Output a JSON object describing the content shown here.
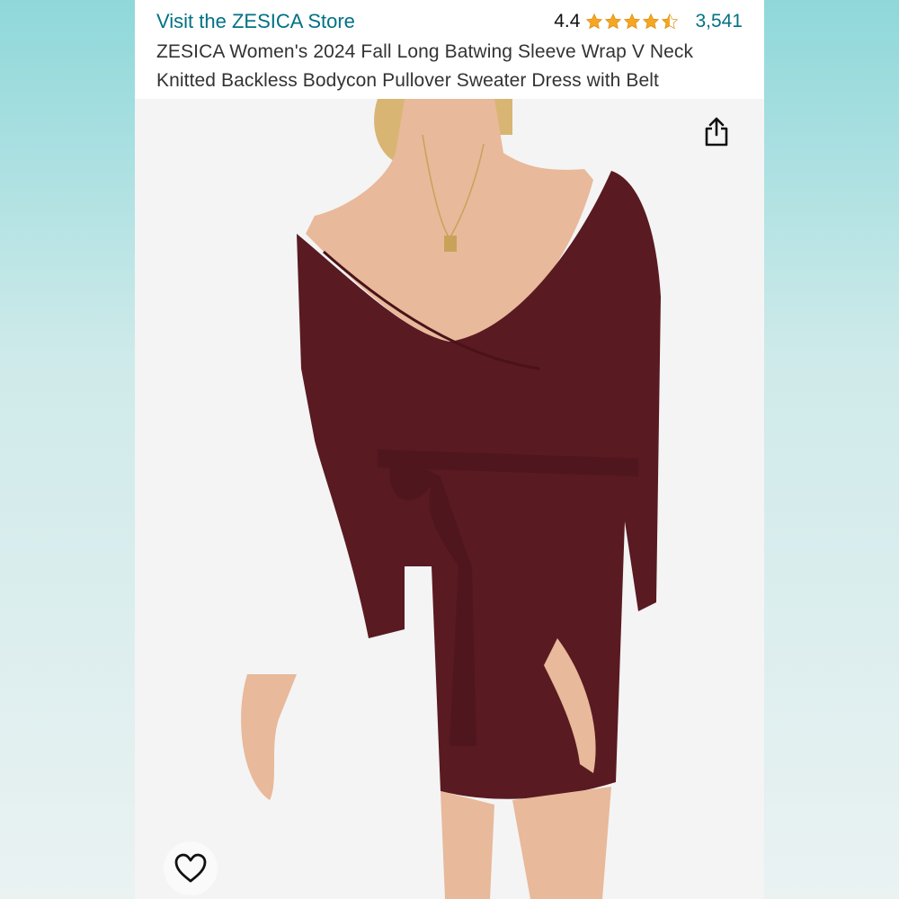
{
  "header": {
    "store_link": "Visit the ZESICA Store",
    "rating_value": "4.4",
    "rating_stars": 4.4,
    "review_count": "3,541",
    "title": "ZESICA Women's 2024 Fall Long Batwing Sleeve Wrap V Neck Knitted Backless Bodycon Pullover Sweater Dress with Belt"
  },
  "image": {
    "product_color": "#5a1a22",
    "skin_color": "#e8b99a",
    "hair_color": "#d9b574"
  },
  "icons": {
    "share": "share-icon",
    "favorite": "heart-icon"
  },
  "colors": {
    "link": "#007185",
    "star": "#f5a623",
    "text": "#333333"
  }
}
